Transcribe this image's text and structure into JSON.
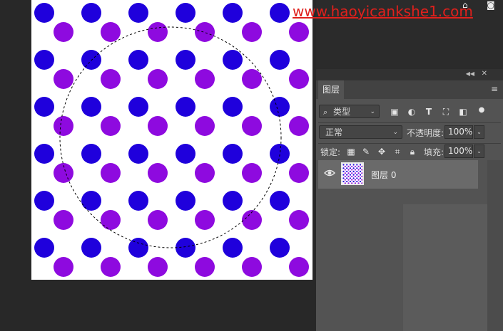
{
  "watermark": "www.haoyicankshe1.com",
  "canvas": {
    "dot_colors": {
      "blue": "#1f00dc",
      "purple": "#8e0adf"
    },
    "selection": "ellipse-marquee"
  },
  "panel": {
    "collapse_icon": "double-chevron-right-icon",
    "close_icon": "close-icon",
    "tab_label": "图层",
    "menu_icon": "hamburger-menu-icon",
    "filter": {
      "search_glyph": "⌕",
      "kind_label": "类型",
      "icons": [
        "image-filter-icon",
        "adjustment-filter-icon",
        "type-filter-icon",
        "shape-filter-icon",
        "smart-object-filter-icon"
      ]
    },
    "blend_mode": "正常",
    "opacity_label": "不透明度:",
    "opacity_value": "100%",
    "lock_label": "锁定:",
    "fill_label": "填充:",
    "fill_value": "100%",
    "layer": {
      "name": "图层 0",
      "visible": true
    }
  },
  "accent": "#e0201c"
}
